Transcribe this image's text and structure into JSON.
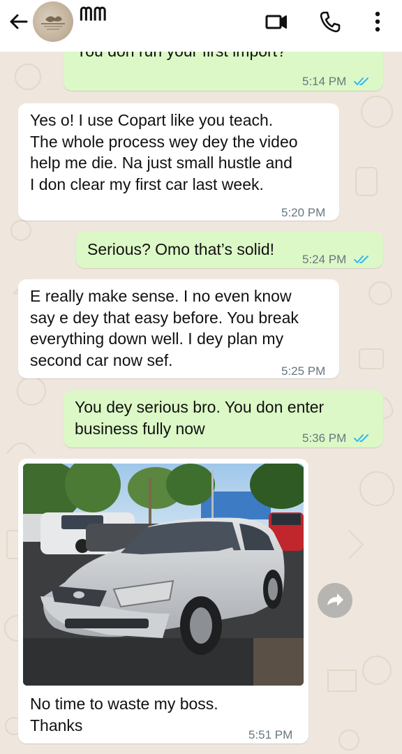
{
  "header": {
    "contact_name": "ᗰᗰ",
    "icons": [
      "back-arrow-icon",
      "avatar",
      "video-call-icon",
      "phone-icon",
      "more-vert-icon"
    ]
  },
  "messages": [
    {
      "id": "m1",
      "direction": "outgoing",
      "text": "You don run your first import?",
      "time": "5:14 PM",
      "status": "read"
    },
    {
      "id": "m2",
      "direction": "incoming",
      "lines": [
        "Yes o! I use Copart like you teach.",
        "The whole process wey dey the video",
        "help me die. Na just small hustle and",
        "I don clear my first car last week."
      ],
      "time": "5:20 PM"
    },
    {
      "id": "m3",
      "direction": "outgoing",
      "text": "Serious? Omo that’s solid!",
      "time": "5:24 PM",
      "status": "read"
    },
    {
      "id": "m4",
      "direction": "incoming",
      "lines": [
        "E really make sense. I no even know",
        "say e dey that easy before. You break",
        "everything down well. I dey plan my",
        "second car now sef."
      ],
      "time": "5:25 PM"
    },
    {
      "id": "m5",
      "direction": "outgoing",
      "lines": [
        "You dey serious bro. You don enter",
        "business fully now"
      ],
      "time": "5:36 PM",
      "status": "read"
    },
    {
      "id": "m6",
      "direction": "incoming",
      "type": "image",
      "image_subject": "silver sedan in parking lot",
      "lines": [
        "No time to waste my boss.",
        "Thanks"
      ],
      "time": "5:51 PM"
    }
  ],
  "colors": {
    "outgoing_bubble": "#dcf8c6",
    "incoming_bubble": "#ffffff",
    "read_ticks": "#34b7f1",
    "chat_background": "#efe7dd"
  }
}
